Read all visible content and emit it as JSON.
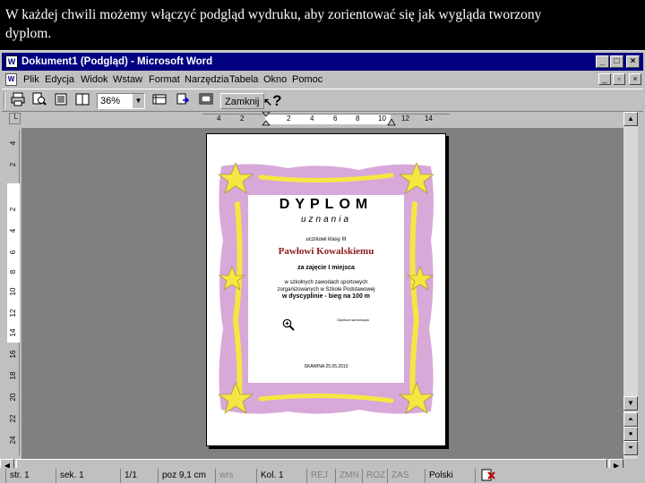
{
  "caption": {
    "line1": "W każdej chwili możemy włączyć podgląd wydruku, aby zorientować się jak wygląda tworzony",
    "line2": "dyplom."
  },
  "window": {
    "title": "Dokument1 (Podgląd) - Microsoft Word",
    "menu": [
      "Plik",
      "Edycja",
      "Widok",
      "Wstaw",
      "Format",
      "Narzędzia",
      "Tabela",
      "Okno",
      "Pomoc"
    ]
  },
  "toolbar": {
    "zoom": "36%",
    "close_label": "Zamknij",
    "help_glyph": "?"
  },
  "ruler": {
    "horizontal_ticks": [
      "4",
      "2",
      "2",
      "4",
      "6",
      "8",
      "10",
      "12",
      "14"
    ],
    "vertical_ticks": [
      "4",
      "2",
      "2",
      "4",
      "6",
      "8",
      "10",
      "12",
      "14",
      "16",
      "18",
      "20",
      "22",
      "24"
    ]
  },
  "diploma": {
    "title": "DYPLOM",
    "subtitle": "uznania",
    "line_for": "uczniowi klasy III",
    "name": "Pawłowi Kowalskiemu",
    "place": "za zajęcie I miejsca",
    "line_competition_1": "w szkolnych zawodach sportowych",
    "line_competition_2": "zorganizowanych w Szkole Podstawowej",
    "line_discipline": "w dyscyplinie - bieg na 100 m",
    "signature": "Opiekun samorządu",
    "date_line": "SKAWINA 25.05.2010"
  },
  "status": {
    "page": "str. 1",
    "section": "sek. 1",
    "pages": "1/1",
    "position": "poz 9,1 cm",
    "line": "wrs",
    "column": "Kol. 1",
    "rec": "REJ",
    "trk": "ZMN",
    "ext": "ROZ",
    "ovr": "ZAS",
    "language": "Polski"
  },
  "colors": {
    "title_bar": "#000080",
    "frame_fill": "#d8a8d8",
    "star_fill": "#f5e642",
    "name_color": "#8b1a1a",
    "workspace": "#808080"
  }
}
